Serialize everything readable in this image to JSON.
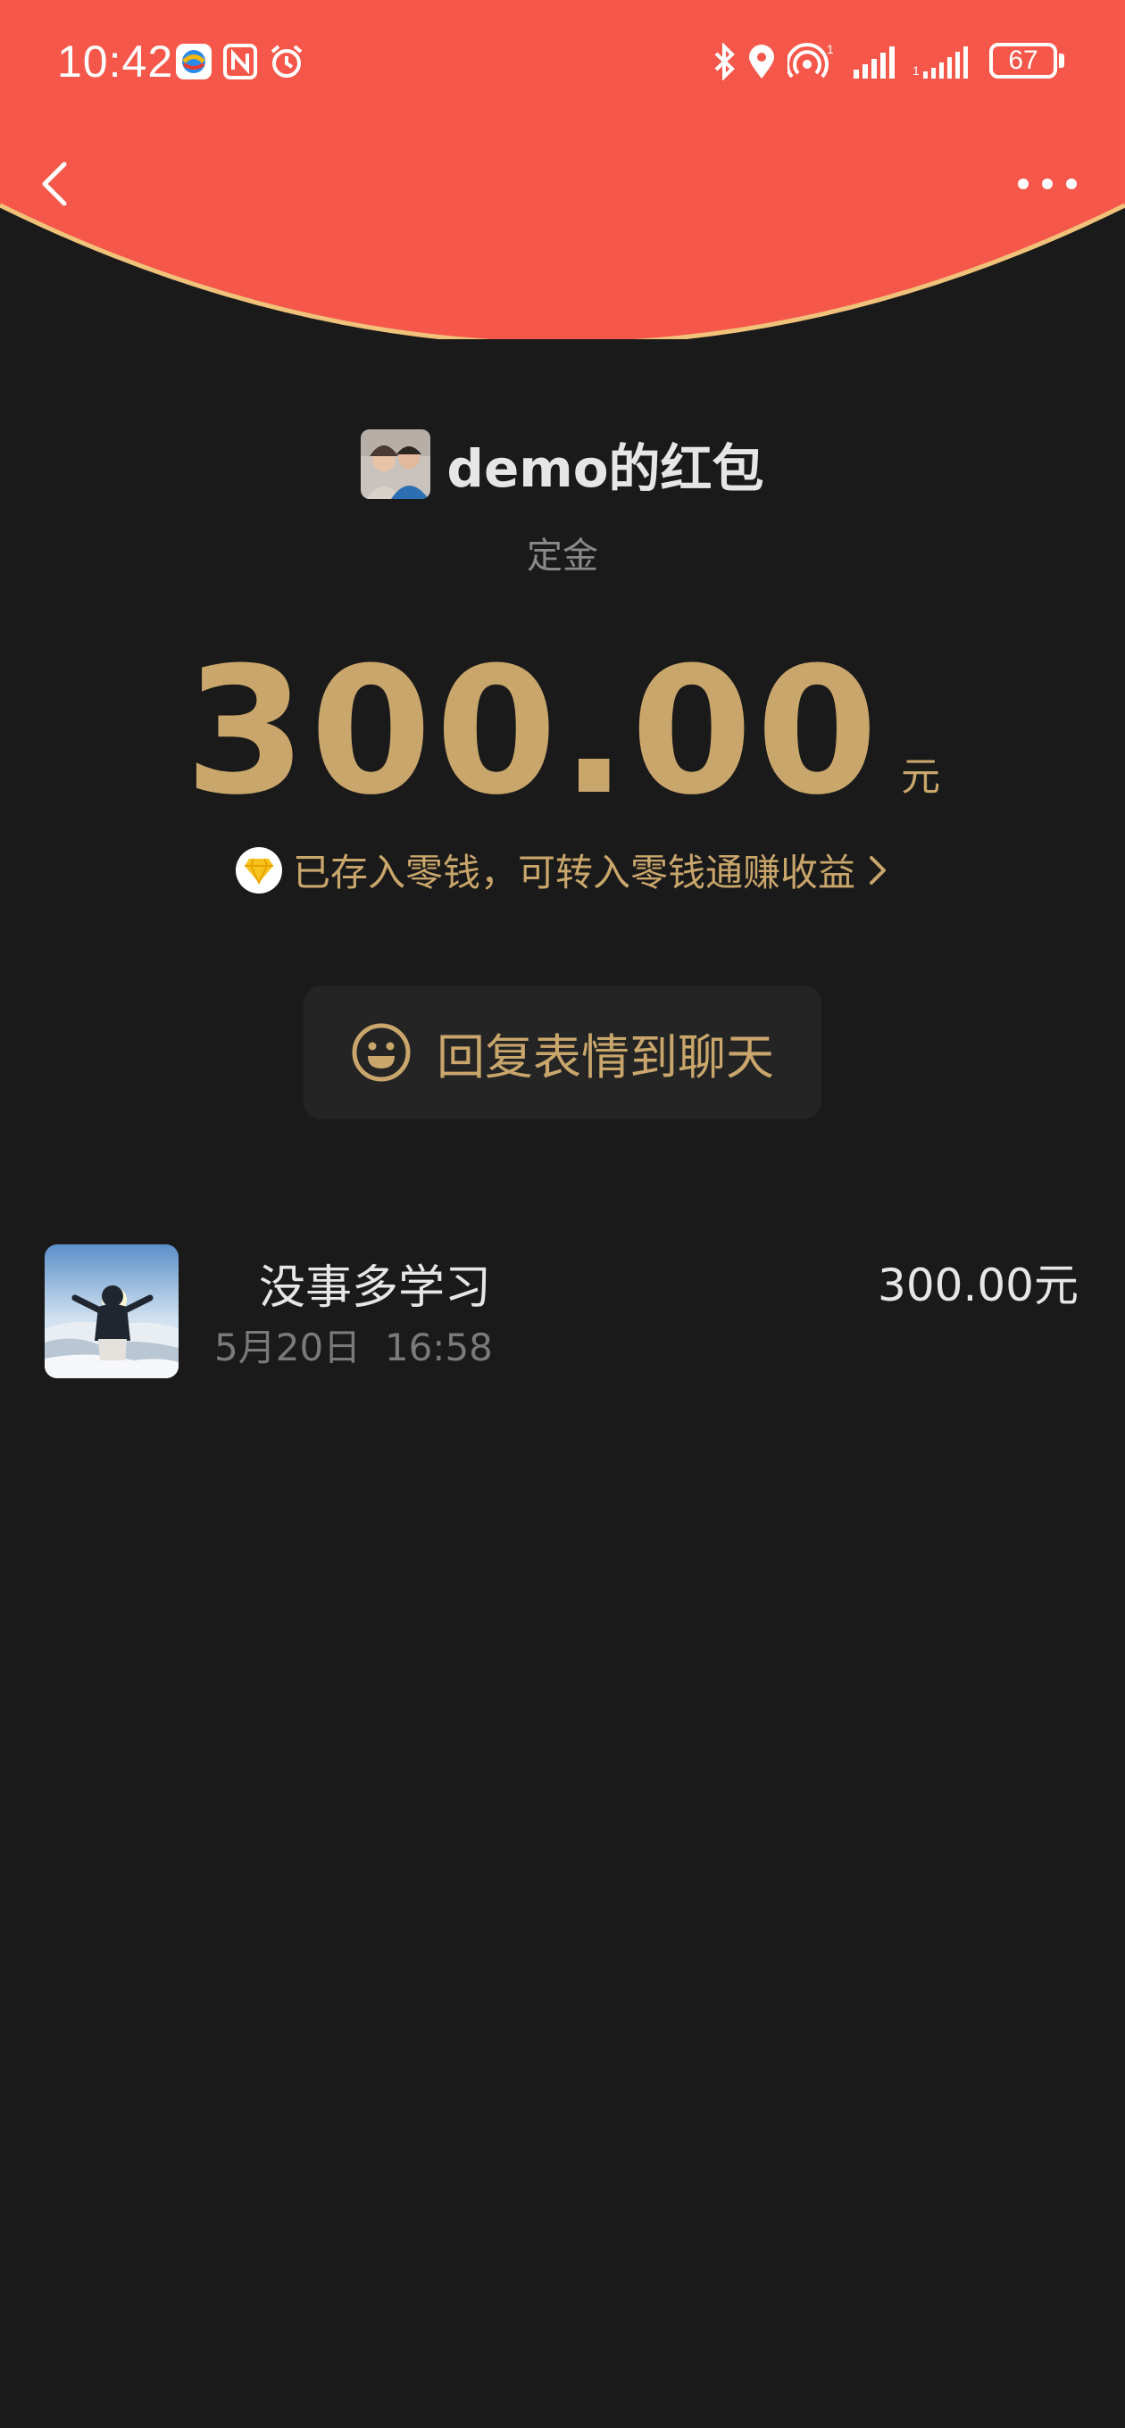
{
  "status_bar": {
    "time": "10:42",
    "battery": "67"
  },
  "header": {
    "back_icon": "chevron-left-icon",
    "more_icon": "more-dots-icon"
  },
  "envelope": {
    "sender_name": "demo的红包",
    "remark": "定金",
    "amount": "300.00",
    "unit": "元",
    "change_notice": "已存入零钱，可转入零钱通赚收益",
    "reply_label": "回复表情到聊天"
  },
  "records": [
    {
      "name": "没事多学习",
      "time": "5月20日  16:58",
      "amount": "300.00元"
    }
  ],
  "colors": {
    "header_red": "#f5584a",
    "gold": "#c9a66b",
    "background": "#1a1a1a"
  }
}
